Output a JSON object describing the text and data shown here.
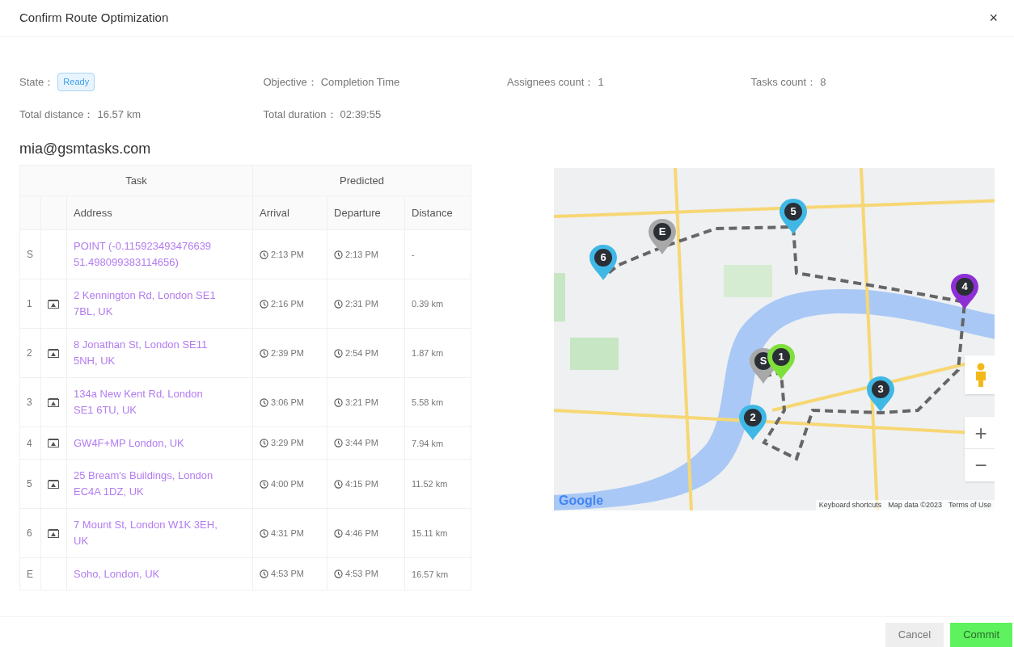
{
  "dialog": {
    "title": "Confirm Route Optimization",
    "close": "×"
  },
  "summary": [
    {
      "label": "State：",
      "badge": "Ready"
    },
    {
      "label": "Objective：",
      "value": "Completion Time"
    },
    {
      "label": "Assignees count：",
      "value": "1"
    },
    {
      "label": "Tasks count：",
      "value": "8"
    },
    {
      "label": "Total distance：",
      "value": "16.57 km"
    },
    {
      "label": "Total duration：",
      "value": "02:39:55"
    }
  ],
  "assignee": "mia@gsmtasks.com",
  "table": {
    "group_headers": [
      "Task",
      "Predicted"
    ],
    "columns": [
      "Address",
      "Arrival",
      "Departure",
      "Distance"
    ],
    "rows": [
      {
        "index": "S",
        "task_icon": false,
        "address": "POINT (-0.115923493476639 51.498099383114656)",
        "arrival": "2:13 PM",
        "departure": "2:13 PM",
        "distance": "-"
      },
      {
        "index": "1",
        "task_icon": true,
        "address": "2 Kennington Rd, London SE1 7BL, UK",
        "arrival": "2:16 PM",
        "departure": "2:31 PM",
        "distance": "0.39 km"
      },
      {
        "index": "2",
        "task_icon": true,
        "address": "8 Jonathan St, London SE11 5NH, UK",
        "arrival": "2:39 PM",
        "departure": "2:54 PM",
        "distance": "1.87 km"
      },
      {
        "index": "3",
        "task_icon": true,
        "address": "134a New Kent Rd, London SE1 6TU, UK",
        "arrival": "3:06 PM",
        "departure": "3:21 PM",
        "distance": "5.58 km"
      },
      {
        "index": "4",
        "task_icon": true,
        "address": "GW4F+MP London, UK",
        "arrival": "3:29 PM",
        "departure": "3:44 PM",
        "distance": "7.94 km"
      },
      {
        "index": "5",
        "task_icon": true,
        "address": "25 Bream's Buildings, London EC4A 1DZ, UK",
        "arrival": "4:00 PM",
        "departure": "4:15 PM",
        "distance": "11.52 km"
      },
      {
        "index": "6",
        "task_icon": true,
        "address": "7 Mount St, London W1K 3EH, UK",
        "arrival": "4:31 PM",
        "departure": "4:46 PM",
        "distance": "15.11 km"
      },
      {
        "index": "E",
        "task_icon": false,
        "address": "Soho, London, UK",
        "arrival": "4:53 PM",
        "departure": "4:53 PM",
        "distance": "16.57 km"
      }
    ]
  },
  "map": {
    "markers": [
      {
        "label": "6",
        "color": "#3fb8e6"
      },
      {
        "label": "E",
        "color": "#a8a8a8"
      },
      {
        "label": "5",
        "color": "#3fb8e6"
      },
      {
        "label": "4",
        "color": "#8e2fd6"
      },
      {
        "label": "S",
        "color": "#a8a8a8"
      },
      {
        "label": "1",
        "color": "#7ee03a"
      },
      {
        "label": "3",
        "color": "#3fb8e6"
      },
      {
        "label": "2",
        "color": "#3fb8e6"
      }
    ],
    "zoom_in": "+",
    "zoom_out": "−",
    "logo": "Google",
    "attribution": [
      "Keyboard shortcuts",
      "Map data ©2023",
      "Terms of Use"
    ]
  },
  "buttons": [
    {
      "label": "Cancel",
      "kind": "secondary"
    },
    {
      "label": "Commit",
      "kind": "primary"
    }
  ]
}
